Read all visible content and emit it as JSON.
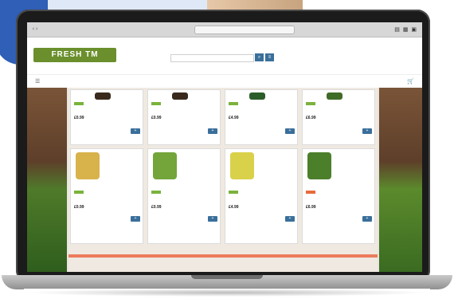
{
  "browser": {
    "tab_title": "",
    "address": "",
    "nav_icons": "‹ ›",
    "toolbar_icons": "▤ ▦ ▣"
  },
  "site": {
    "logo_text": "FRESH TM",
    "search_placeholder": "",
    "search_btn": "⌕",
    "search_btn2": "≡",
    "menu_icon": "☰",
    "cart_icon": "🛒",
    "nav_links": [
      "",
      "",
      "",
      "",
      "",
      ""
    ]
  },
  "products": [
    {
      "name": "",
      "price": "£0.99",
      "more": "",
      "color": "#3a2a1e",
      "img_type": "thumb"
    },
    {
      "name": "",
      "price": "£0.99",
      "more": "",
      "color": "#3a2a1e",
      "img_type": "thumb"
    },
    {
      "name": "",
      "price": "£4.99",
      "more": "",
      "color": "#2b5d2a",
      "img_type": "thumb"
    },
    {
      "name": "",
      "price": "£6.99",
      "more": "",
      "color": "#3f6c26",
      "img_type": "thumb"
    },
    {
      "name": "",
      "price": "£0.99",
      "more": "",
      "color": "#d8b24b",
      "img_type": "big"
    },
    {
      "name": "",
      "price": "£0.99",
      "more": "",
      "color": "#73a53b",
      "img_type": "big"
    },
    {
      "name": "",
      "price": "£4.99",
      "more": "",
      "color": "#d9d14a",
      "img_type": "big"
    },
    {
      "name": "",
      "price": "£6.99",
      "more": "",
      "color": "#4c7f2a",
      "img_type": "big"
    }
  ],
  "colors": {
    "accent_green": "#7ab33c",
    "button_blue": "#3a6f9b",
    "promo": "#ec7b5b"
  }
}
